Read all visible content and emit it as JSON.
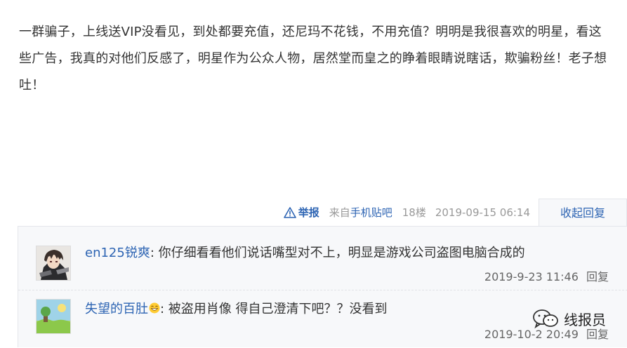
{
  "post": {
    "content": "一群骗子，上线送VIP没看见，到处都要充值，还尼玛不花钱，不用充值？明明是我很喜欢的明星，看这些广告，我真的对他们反感了，明星作为公众人物，居然堂而皇之的睁着眼睛说瞎话，欺骗粉丝！老子想吐！"
  },
  "tail": {
    "report_label": "举报",
    "source_prefix": "来自",
    "source_link": "手机贴吧",
    "floor": "18楼",
    "time": "2019-09-15 06:14",
    "collapse_label": "收起回复"
  },
  "replies": [
    {
      "username": "en125锐爽",
      "colon": ":",
      "text": " 你仔细看看他们说话嘴型对不上，明显是游戏公司盗图电脑合成的",
      "time": "2019-9-23 11:46",
      "reply_label": "回复",
      "avatar_icon": "anime-avatar-icon"
    },
    {
      "username": "失望的百肚",
      "colon": ":",
      "text": " 被盗用肖像 得自己澄清下吧？？没看到",
      "time": "2019-10-2 20:49",
      "reply_label": "回复",
      "avatar_icon": "landscape-avatar-icon",
      "emoji_icon": "grin-emoji-icon"
    }
  ],
  "watermark": {
    "text": "线报员",
    "icon": "wechat-icon"
  },
  "colors": {
    "link": "#2d64b3",
    "muted": "#999999",
    "panel_bg": "#f7f8fa"
  }
}
